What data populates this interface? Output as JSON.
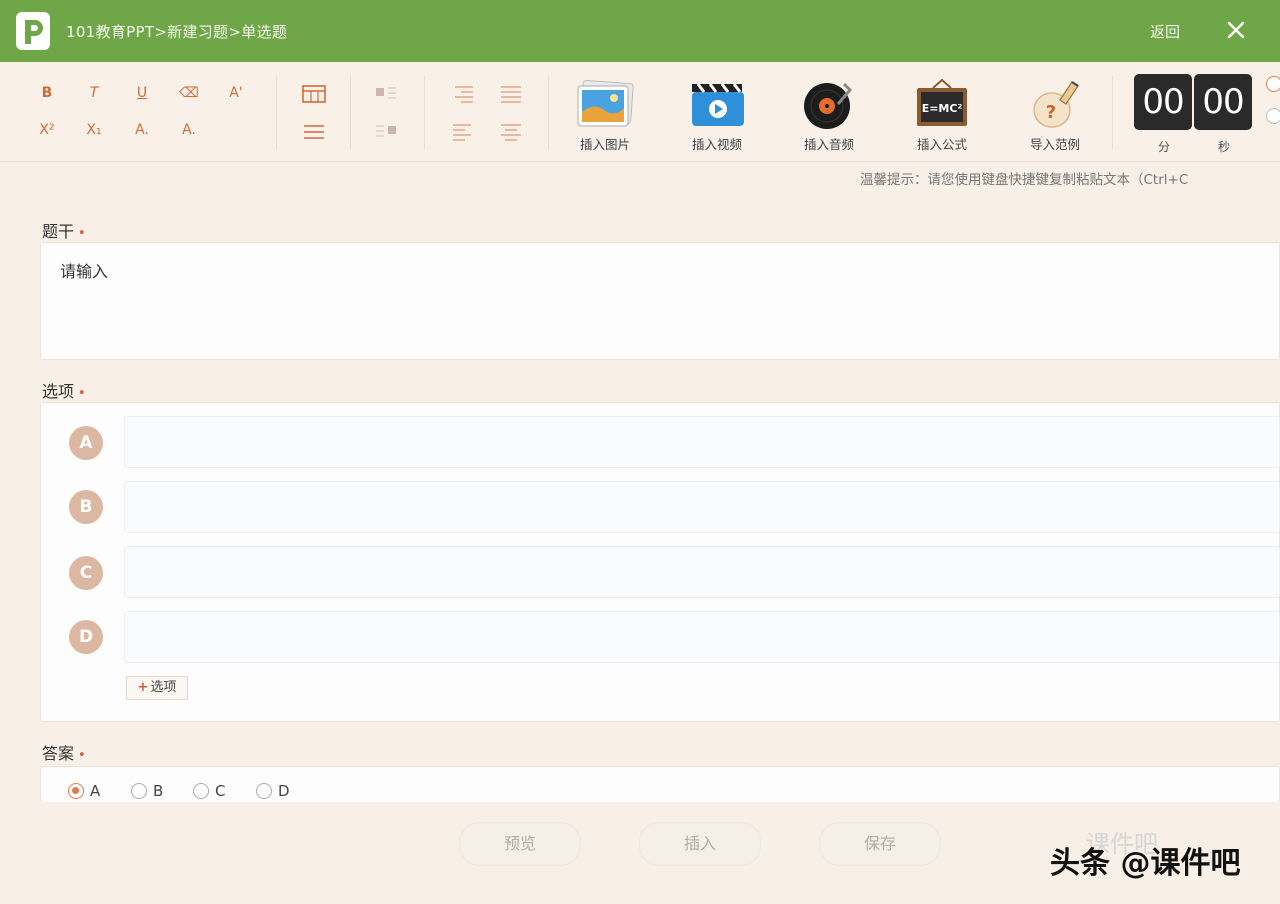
{
  "app": {
    "breadcrumb": "101教育PPT>新建习题>单选题",
    "back_label": "返回",
    "accent_color": "#6ea648"
  },
  "toolbar": {
    "format_row1": [
      "B",
      "T",
      "U",
      "⌫",
      "A'"
    ],
    "format_row2": [
      "X²",
      "X₁",
      "A.",
      "A."
    ],
    "insert_items": [
      {
        "label": "插入图片",
        "icon": "image-icon"
      },
      {
        "label": "插入视频",
        "icon": "video-icon"
      },
      {
        "label": "插入音频",
        "icon": "audio-icon"
      },
      {
        "label": "插入公式",
        "icon": "formula-icon"
      },
      {
        "label": "导入范例",
        "icon": "import-example-icon"
      }
    ],
    "timer": {
      "minutes": "00",
      "seconds": "00",
      "minutes_label": "分",
      "seconds_label": "秒"
    }
  },
  "tip": "温馨提示：请您使用键盘快捷键复制粘贴文本（Ctrl+C",
  "stem": {
    "label": "题干",
    "required_mark": "•",
    "placeholder": "请输入"
  },
  "options": {
    "label": "选项",
    "required_mark": "•",
    "items": [
      {
        "letter": "A",
        "value": ""
      },
      {
        "letter": "B",
        "value": ""
      },
      {
        "letter": "C",
        "value": ""
      },
      {
        "letter": "D",
        "value": ""
      }
    ],
    "add_label": "选项",
    "add_symbol": "+"
  },
  "answer": {
    "label": "答案",
    "required_mark": "•",
    "choices": [
      "A",
      "B",
      "C",
      "D"
    ],
    "selected": "A"
  },
  "actions": {
    "preview": "预览",
    "insert": "插入",
    "save": "保存"
  },
  "watermark": {
    "text": "头条 @课件吧",
    "faint": "课件吧"
  }
}
